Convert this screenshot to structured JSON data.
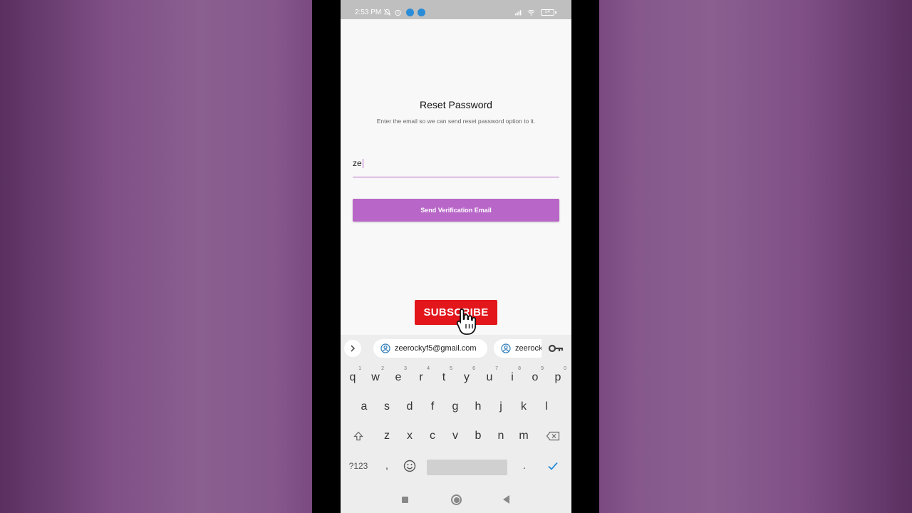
{
  "status_bar": {
    "time": "2:53 PM",
    "battery": "54"
  },
  "page": {
    "title": "Reset Password",
    "subtitle": "Enter the email so we can send reset password option to it.",
    "email_value": "ze",
    "send_button_label": "Send Verification Email",
    "accent_color": "#b866c8"
  },
  "overlay": {
    "subscribe_label": "SUBSCRIBE"
  },
  "keyboard": {
    "suggestions": [
      "zeerockyf5@gmail.com",
      "zeerock"
    ],
    "row1": [
      {
        "k": "q",
        "n": "1"
      },
      {
        "k": "w",
        "n": "2"
      },
      {
        "k": "e",
        "n": "3"
      },
      {
        "k": "r",
        "n": "4"
      },
      {
        "k": "t",
        "n": "5"
      },
      {
        "k": "y",
        "n": "6"
      },
      {
        "k": "u",
        "n": "7"
      },
      {
        "k": "i",
        "n": "8"
      },
      {
        "k": "o",
        "n": "9"
      },
      {
        "k": "p",
        "n": "0"
      }
    ],
    "row2": [
      "a",
      "s",
      "d",
      "f",
      "g",
      "h",
      "j",
      "k",
      "l"
    ],
    "row3": [
      "z",
      "x",
      "c",
      "v",
      "b",
      "n",
      "m"
    ],
    "symbols_label": "?123",
    "comma": ",",
    "period": "."
  },
  "icons": {
    "status": [
      "mute-bell-icon",
      "alarm-icon",
      "notification-dot-icon",
      "notification-dot-icon",
      "signal-icon",
      "wifi-icon",
      "battery-icon"
    ],
    "keyboard": [
      "chevron-right-icon",
      "account-icon",
      "key-icon",
      "shift-icon",
      "backspace-icon",
      "emoji-icon",
      "check-icon"
    ],
    "nav": [
      "recents-icon",
      "home-icon",
      "back-icon"
    ]
  }
}
